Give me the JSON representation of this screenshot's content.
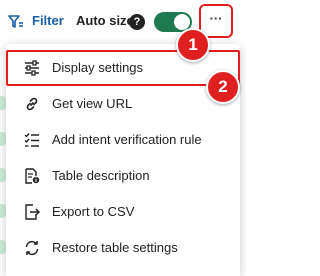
{
  "toolbar": {
    "filter_label": "Filter",
    "autosize_label": "Auto size",
    "help_glyph": "?",
    "autosize_enabled": true,
    "more_glyph": "···",
    "icons": {
      "filter": "filter-icon",
      "help": "help-icon"
    }
  },
  "menu": {
    "items": [
      {
        "label": "Display settings",
        "icon": "sliders-icon"
      },
      {
        "label": "Get view URL",
        "icon": "link-icon"
      },
      {
        "label": "Add intent verification rule",
        "icon": "checklist-icon"
      },
      {
        "label": "Table description",
        "icon": "document-info-icon"
      },
      {
        "label": "Export to CSV",
        "icon": "export-icon"
      },
      {
        "label": "Restore table settings",
        "icon": "refresh-icon"
      }
    ]
  },
  "callouts": {
    "badge_1": "1",
    "badge_2": "2"
  },
  "colors": {
    "accent_blue": "#1a5ea8",
    "toggle_green": "#1e7a50",
    "highlight_red": "#e02020",
    "text": "#222222"
  }
}
